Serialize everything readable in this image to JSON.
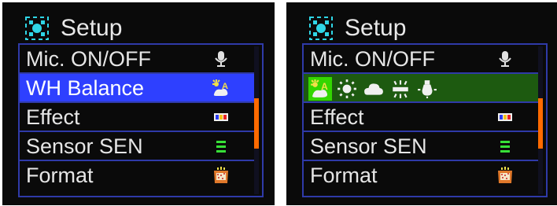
{
  "screens": {
    "left": {
      "title": "Setup",
      "items": [
        {
          "label": "Mic. ON/OFF",
          "icon": "microphone-icon"
        },
        {
          "label": "WH Balance",
          "icon": "auto-white-balance-icon"
        },
        {
          "label": "Effect",
          "icon": "color-effect-icon"
        },
        {
          "label": "Sensor SEN",
          "icon": "sensor-sensitivity-icon"
        },
        {
          "label": "Format",
          "icon": "format-card-icon"
        }
      ],
      "selected_item": "WH Balance",
      "scroll_position_fraction": 0.35
    },
    "right": {
      "title": "Setup",
      "items": [
        {
          "label": "Mic. ON/OFF",
          "icon": "microphone-icon"
        },
        {
          "label": "",
          "icon": "white-balance-options"
        },
        {
          "label": "Effect",
          "icon": "color-effect-icon"
        },
        {
          "label": "Sensor SEN",
          "icon": "sensor-sensitivity-icon"
        },
        {
          "label": "Format",
          "icon": "format-card-icon"
        }
      ],
      "wb_options": [
        {
          "icon": "auto-white-balance-icon",
          "active": true
        },
        {
          "icon": "sunny-icon",
          "active": false
        },
        {
          "icon": "cloudy-icon",
          "active": false
        },
        {
          "icon": "fluorescent-icon",
          "active": false
        },
        {
          "icon": "incandescent-icon",
          "active": false
        }
      ],
      "scroll_position_fraction": 0.35
    }
  },
  "colors": {
    "screen_bg": "#0a0a0a",
    "frame_border": "#2f3aa8",
    "highlight_blue": "#2e40ff",
    "highlight_green": "#1d5a10",
    "active_option": "#33d600",
    "scroll_thumb": "#ff6a00",
    "text": "#e6e6e6"
  }
}
